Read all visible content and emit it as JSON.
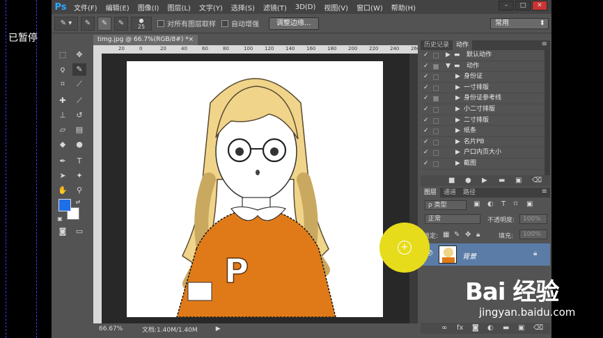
{
  "recorder": {
    "status": "已暂停"
  },
  "app": {
    "logo": "Ps"
  },
  "menu": [
    "文件(F)",
    "编辑(E)",
    "图像(I)",
    "图层(L)",
    "文字(Y)",
    "选择(S)",
    "滤镜(T)",
    "3D(D)",
    "视图(V)",
    "窗口(W)",
    "帮助(H)"
  ],
  "window_buttons": {
    "minimize": "–",
    "restore": "□",
    "close": "✕"
  },
  "options_bar": {
    "brush_size": "25",
    "sample_all_layers": "对所有图层取样",
    "auto_enhance": "自动增强",
    "refine_edge": "调整边缘...",
    "workspace": "常用"
  },
  "document": {
    "tab_title": "timg.jpg @ 66.7%(RGB/8#) *",
    "tab_close": "×",
    "ruler_ticks": [
      "20",
      "0",
      "20",
      "40",
      "60",
      "80",
      "100",
      "120",
      "140",
      "160",
      "180",
      "200",
      "220",
      "240",
      "260"
    ],
    "zoom": "66.67%",
    "doc_info": "文档:1.40M/1.40M"
  },
  "panel_top": {
    "tabs": [
      "历史记录",
      "动作"
    ],
    "active_tab": "动作",
    "actions": [
      {
        "label": "默认动作",
        "folder": true,
        "indent": 0,
        "expanded": false
      },
      {
        "label": "动作",
        "folder": true,
        "indent": 0,
        "expanded": true
      },
      {
        "label": "身份证",
        "folder": false,
        "indent": 1
      },
      {
        "label": "一寸排版",
        "folder": false,
        "indent": 1
      },
      {
        "label": "身份证参考线",
        "folder": false,
        "indent": 1
      },
      {
        "label": "小二寸排版",
        "folder": false,
        "indent": 1
      },
      {
        "label": "二寸排版",
        "folder": false,
        "indent": 1
      },
      {
        "label": "纸条",
        "folder": false,
        "indent": 1
      },
      {
        "label": "名片PB",
        "folder": false,
        "indent": 1
      },
      {
        "label": "户口内页大小",
        "folder": false,
        "indent": 1
      },
      {
        "label": "截图",
        "folder": false,
        "indent": 1
      }
    ]
  },
  "panel_layers": {
    "tabs": [
      "图层",
      "通道",
      "路径"
    ],
    "active_tab": "图层",
    "kind_filter": "ρ 类型",
    "blend_mode": "正常",
    "opacity_label": "不透明度:",
    "opacity_value": "100%",
    "lock_label": "锁定:",
    "fill_label": "填充:",
    "fill_value": "100%",
    "layer_name": "背景"
  },
  "watermark": {
    "logo": "Bai 经验",
    "url": "jingyan.baidu.com"
  },
  "colors": {
    "foreground": "#1e6fe8",
    "background": "#ffffff",
    "shirt": "#e07a18",
    "hair": "#f0d48a",
    "cursor": "#e6dc1c",
    "layer_selected": "#5b7ca6"
  }
}
